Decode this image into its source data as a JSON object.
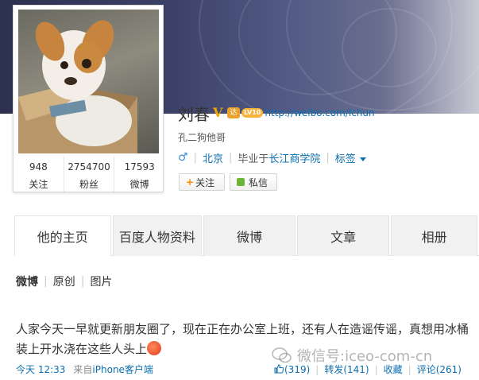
{
  "profile": {
    "name": "刘春",
    "verified_mark": "V",
    "vip_label": "LV10",
    "homepage_link": "http://weibo.com/lchun",
    "bio": "孔二狗他哥",
    "location": "北京",
    "education_prefix": "毕业于",
    "school": "长江商学院",
    "tags_label": "标签",
    "follow_label": "关注",
    "message_label": "私信",
    "stats": [
      {
        "value": "948",
        "label": "关注"
      },
      {
        "value": "2754700",
        "label": "粉丝"
      },
      {
        "value": "17593",
        "label": "微博"
      }
    ]
  },
  "tabs": [
    {
      "label": "他的主页"
    },
    {
      "label": "百度人物资料"
    },
    {
      "label": "微博"
    },
    {
      "label": "文章"
    },
    {
      "label": "相册"
    }
  ],
  "sub_tabs": [
    {
      "label": "微博"
    },
    {
      "label": "原创"
    },
    {
      "label": "图片"
    }
  ],
  "post": {
    "text": "人家今天一早就更新朋友圈了，现在正在办公室上班，还有人在造谣传谣，真想用冰桶装上开水浇在这些人头上",
    "time": "今天 12:33",
    "via_prefix": "来自",
    "via_client": "iPhone客户端",
    "likes": "(319)",
    "repost": "转发(141)",
    "favorite": "收藏",
    "comment": "评论(261)"
  },
  "watermark": "微信号:iceo-com-cn",
  "colors": {
    "link_blue": "#0a6fb0",
    "verified_gold": "#f0a800",
    "follow_orange": "#ff8c00",
    "message_green": "#6cb534"
  }
}
